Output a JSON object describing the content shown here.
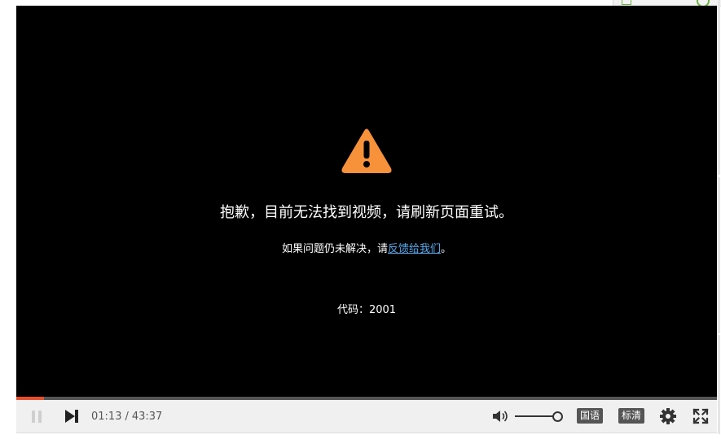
{
  "player": {
    "error": {
      "icon": "warning-triangle-icon",
      "title": "抱歉，目前无法找到视频，请刷新页面重试。",
      "subtitle_prefix": "如果问题仍未解决，请",
      "feedback_link": "反馈给我们",
      "subtitle_suffix": "。",
      "code_label": "代码：",
      "code_value": "2001"
    },
    "colors": {
      "background": "#000000",
      "warning": "#f7923a",
      "link": "#5aa8ec",
      "progress": "#e8502b"
    },
    "progress_fraction": 0.04,
    "controls": {
      "pause_icon": "pause-icon",
      "next_icon": "next-icon",
      "current_time": "01:13",
      "separator": "/",
      "duration": "43:37",
      "volume_icon": "volume-icon",
      "volume_level": 1.0,
      "language_label": "国语",
      "quality_label": "标清",
      "settings_icon": "gear-icon",
      "fullscreen_icon": "fullscreen-icon"
    }
  }
}
